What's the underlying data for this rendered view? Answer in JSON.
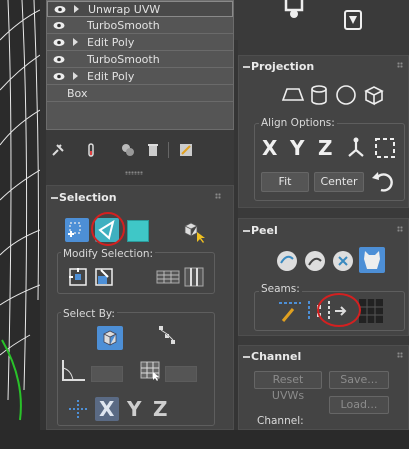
{
  "modifier_stack": {
    "items": [
      {
        "label": "Unwrap UVW",
        "has_eye": true,
        "has_expand": true,
        "selected": true
      },
      {
        "label": "TurboSmooth",
        "has_eye": true,
        "has_expand": false
      },
      {
        "label": "Edit Poly",
        "has_eye": true,
        "has_expand": true
      },
      {
        "label": "TurboSmooth",
        "has_eye": true,
        "has_expand": false
      },
      {
        "label": "Edit Poly",
        "has_eye": true,
        "has_expand": true
      },
      {
        "label": "Box",
        "has_eye": false,
        "has_expand": false
      }
    ]
  },
  "stack_toolbar": {
    "icons": [
      "pin-stack-icon",
      "show-end-result-icon",
      "make-unique-icon",
      "remove-modifier-icon",
      "configure-modifier-sets-icon"
    ]
  },
  "selection": {
    "title": "Selection",
    "modify_selection_label": "Modify Selection:",
    "select_by_label": "Select By:",
    "letters": [
      "X",
      "Y",
      "Z"
    ]
  },
  "projection": {
    "title": "Projection",
    "align_options_label": "Align Options:",
    "letters": [
      "X",
      "Y",
      "Z"
    ],
    "fit_label": "Fit",
    "center_label": "Center"
  },
  "peel": {
    "title": "Peel",
    "seams_label": "Seams:"
  },
  "channel": {
    "title": "Channel",
    "reset_uvws_label": "Reset UVWs",
    "save_label": "Save...",
    "load_label": "Load...",
    "channel_label": "Channel:"
  },
  "colors": {
    "accent_blue": "#4d8fd6",
    "teal": "#3fc7c7",
    "annotation_red": "#d42020",
    "panel_bg": "#444444"
  }
}
